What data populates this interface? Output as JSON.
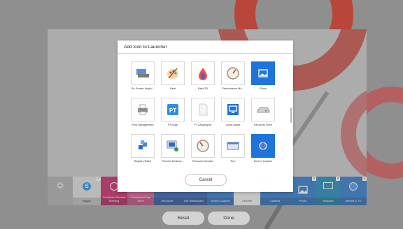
{
  "dialog": {
    "title": "Add Icon to Launcher",
    "cancel_label": "Cancel",
    "items": [
      {
        "label": "On-Screen Keybo...",
        "icon": "keyboard-icon"
      },
      {
        "label": "Paint",
        "icon": "paint-palette-icon"
      },
      {
        "label": "Paint 3D",
        "icon": "paint3d-droplet-icon"
      },
      {
        "label": "Performance Mo...",
        "icon": "performance-gauge-icon"
      },
      {
        "label": "Photo",
        "icon": "photo-icon",
        "selected": true
      },
      {
        "label": "Print Management",
        "icon": "printer-icon"
      },
      {
        "label": "PTZApp",
        "icon": "ptz-app-icon"
      },
      {
        "label": "PTZAppAgent",
        "icon": "blank-document-icon"
      },
      {
        "label": "Quick Assist",
        "icon": "quick-assist-monitor-icon"
      },
      {
        "label": "Recovery Drive",
        "icon": "recovery-drive-icon"
      },
      {
        "label": "Registry Editor",
        "icon": "registry-cubes-icon"
      },
      {
        "label": "Remote Desktop...",
        "icon": "remote-desktop-icon"
      },
      {
        "label": "Resource Monitor",
        "icon": "resource-gauge-icon"
      },
      {
        "label": "Run",
        "icon": "run-window-icon"
      },
      {
        "label": "Screen Capture",
        "icon": "screen-capture-icon",
        "selected": true
      }
    ]
  },
  "taskbar": [
    {
      "label": "",
      "icon": "plus-icon",
      "color": "#a6a6a6"
    },
    {
      "label": "Skype",
      "icon": "skype-icon",
      "color": "#d9d9d9",
      "dark_text": true,
      "bold": true
    },
    {
      "label": "OneQuick Remote Meeting",
      "icon": "onequick-icon",
      "color": "#c2185b"
    },
    {
      "label": "Conference App Store",
      "icon": "",
      "color": "#d64a8a"
    },
    {
      "label": "MS Store",
      "icon": "",
      "color": "#1f56a8"
    },
    {
      "label": "MS Whiteboard",
      "icon": "",
      "color": "#1f56a8"
    },
    {
      "label": "Screen Capture",
      "icon": "",
      "color": "#1e6fc7"
    },
    {
      "label": "Chrome",
      "icon": "",
      "color": "#ececec",
      "dark_text": true
    },
    {
      "label": "Camera",
      "icon": "",
      "color": "#1e6fc7"
    },
    {
      "label": "Photo",
      "icon": "photo-icon",
      "color": "#1e6fc7"
    },
    {
      "label": "Miracast",
      "icon": "miracast-icon",
      "color": "#0f7fb0"
    },
    {
      "label": "Movies & TV",
      "icon": "movies-tv-icon",
      "color": "#1e6fc7"
    }
  ],
  "footer": {
    "reset_label": "Reset",
    "done_label": "Done"
  }
}
